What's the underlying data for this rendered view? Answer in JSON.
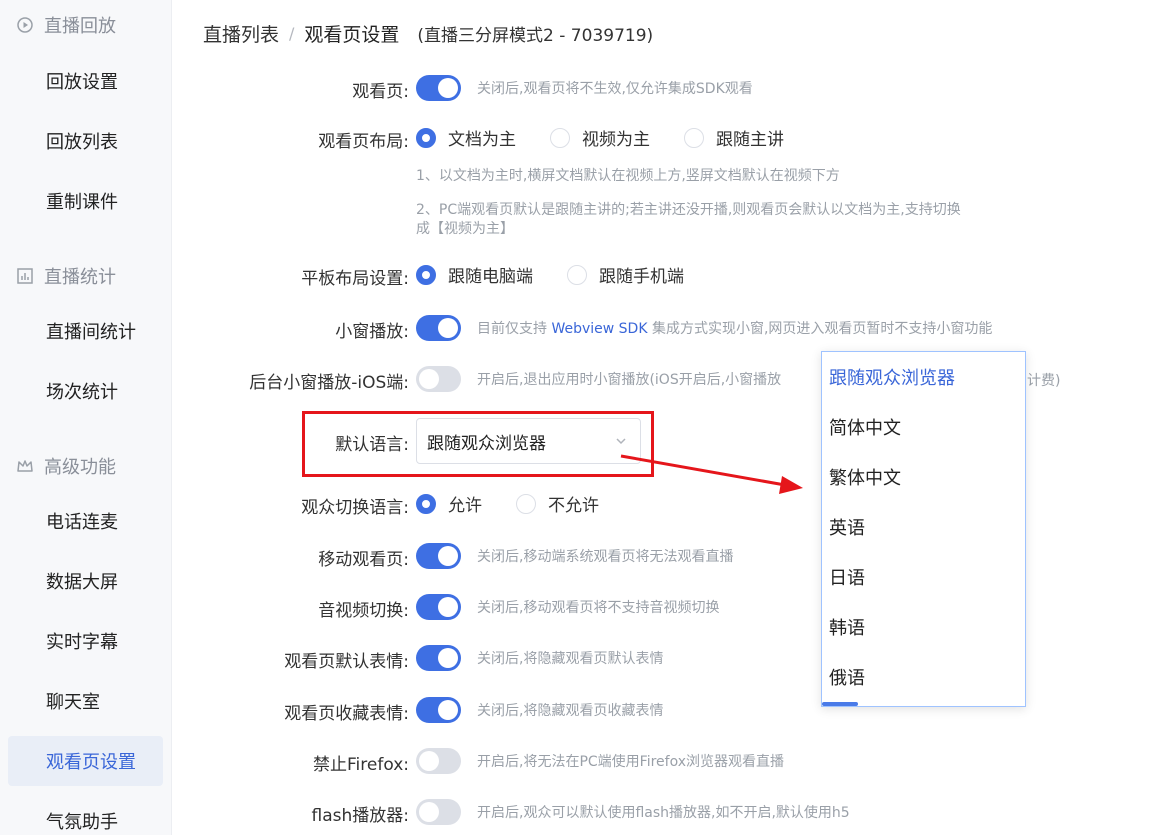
{
  "sidebar": {
    "sections": [
      {
        "label": "直播回放",
        "icon": "replay-icon"
      },
      {
        "label": "直播统计",
        "icon": "stats-icon"
      },
      {
        "label": "高级功能",
        "icon": "crown-icon"
      }
    ],
    "items": [
      {
        "label": "回放设置"
      },
      {
        "label": "回放列表"
      },
      {
        "label": "重制课件"
      },
      {
        "label": "直播间统计"
      },
      {
        "label": "场次统计"
      },
      {
        "label": "电话连麦"
      },
      {
        "label": "数据大屏"
      },
      {
        "label": "实时字幕"
      },
      {
        "label": "聊天室"
      },
      {
        "label": "观看页设置"
      },
      {
        "label": "气氛助手"
      }
    ]
  },
  "breadcrumb": {
    "root": "直播列表",
    "separator": "/",
    "current": "观看页设置",
    "subtitle": "(直播三分屏模式2 - 7039719)"
  },
  "settings": {
    "watch_page": {
      "label": "观看页:",
      "on": true,
      "hint": "关闭后,观看页将不生效,仅允许集成SDK观看"
    },
    "layout": {
      "label": "观看页布局:",
      "options": [
        "文档为主",
        "视频为主",
        "跟随主讲"
      ],
      "selected": 0,
      "note1": "1、以文档为主时,横屏文档默认在视频上方,竖屏文档默认在视频下方",
      "note2a": "2、PC端观看页默认是跟随主讲的;若主讲还没开播,则观看页会默认以文档为主,支持切换",
      "note2b": "成【视频为主】"
    },
    "tablet": {
      "label": "平板布局设置:",
      "options": [
        "跟随电脑端",
        "跟随手机端"
      ],
      "selected": 0
    },
    "mini_window": {
      "label": "小窗播放:",
      "on": true,
      "hint_pre": "目前仅支持 ",
      "hint_link": "Webview SDK",
      "hint_post": " 集成方式实现小窗,网页进入观看页暂时不支持小窗功能"
    },
    "bg_mini_ios": {
      "label": "后台小窗播放-iOS端:",
      "on": false,
      "hint_a": "开启后,退出应用时小窗播放(iOS开启后,小窗播放",
      "hint_b": "常计费)"
    },
    "default_lang": {
      "label": "默认语言:",
      "value": "跟随观众浏览器"
    },
    "switch_lang": {
      "label": "观众切换语言:",
      "options": [
        "允许",
        "不允许"
      ],
      "selected": 0
    },
    "mobile_page": {
      "label": "移动观看页:",
      "on": true,
      "hint": "关闭后,移动端系统观看页将无法观看直播"
    },
    "av_switch": {
      "label": "音视频切换:",
      "on": true,
      "hint": "关闭后,移动观看页将不支持音视频切换"
    },
    "default_emoji": {
      "label": "观看页默认表情:",
      "on": true,
      "hint": "关闭后,将隐藏观看页默认表情"
    },
    "fav_emoji": {
      "label": "观看页收藏表情:",
      "on": true,
      "hint": "关闭后,将隐藏观看页收藏表情"
    },
    "ban_firefox": {
      "label": "禁止Firefox:",
      "on": false,
      "hint": "开启后,将无法在PC端使用Firefox浏览器观看直播"
    },
    "flash_player": {
      "label": "flash播放器:",
      "on": false,
      "hint": "开启后,观众可以默认使用flash播放器,如不开启,默认使用h5"
    }
  },
  "dropdown": {
    "options": [
      "跟随观众浏览器",
      "简体中文",
      "繁体中文",
      "英语",
      "日语",
      "韩语",
      "俄语"
    ],
    "selected": 0
  },
  "colors": {
    "accent": "#3e6fe3",
    "annotation": "#e5161b"
  }
}
